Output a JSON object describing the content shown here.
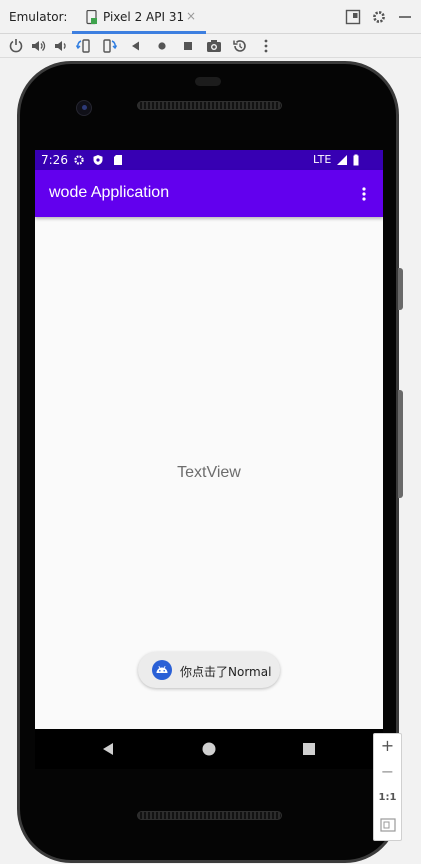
{
  "emulator": {
    "label": "Emulator:",
    "tab_title": "Pixel 2 API 31",
    "tab_close": "×"
  },
  "toolbar": {
    "icons": [
      "power-icon",
      "volume-up-icon",
      "volume-down-icon",
      "rotate-left-icon",
      "rotate-right-icon",
      "back-icon",
      "home-icon",
      "overview-icon",
      "screenshot-icon",
      "snapshot-icon",
      "more-icon"
    ]
  },
  "status_bar": {
    "time": "7:26",
    "network": "LTE"
  },
  "app": {
    "title": "wode Application",
    "textview": "TextView",
    "toast": "你点击了Normal"
  },
  "zoom": {
    "zoom_in": "+",
    "zoom_out": "−",
    "actual_size": "1:1"
  },
  "colors": {
    "status_bar": "#3700b3",
    "app_bar": "#6200ee",
    "tab_accent": "#3d7fe0"
  }
}
